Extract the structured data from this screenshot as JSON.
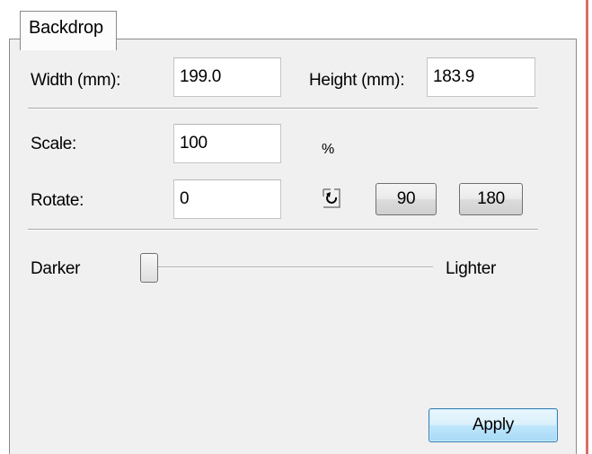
{
  "tab": {
    "label": "Backdrop"
  },
  "fields": {
    "width": {
      "label": "Width (mm):",
      "value": "199.0"
    },
    "height": {
      "label": "Height (mm):",
      "value": "183.9"
    },
    "scale": {
      "label": "Scale:",
      "value": "100",
      "unit": "%"
    },
    "rotate": {
      "label": "Rotate:",
      "value": "0"
    }
  },
  "rotate_buttons": {
    "icon": "rotate-ccw-icon",
    "btn_90": "90",
    "btn_180": "180"
  },
  "brightness": {
    "left_label": "Darker",
    "right_label": "Lighter",
    "level": 0
  },
  "apply_label": "Apply",
  "colors": {
    "panel_bg": "#f0f0f0",
    "apply_accent": "#3c7fb1",
    "window_edge": "#e06a62"
  }
}
